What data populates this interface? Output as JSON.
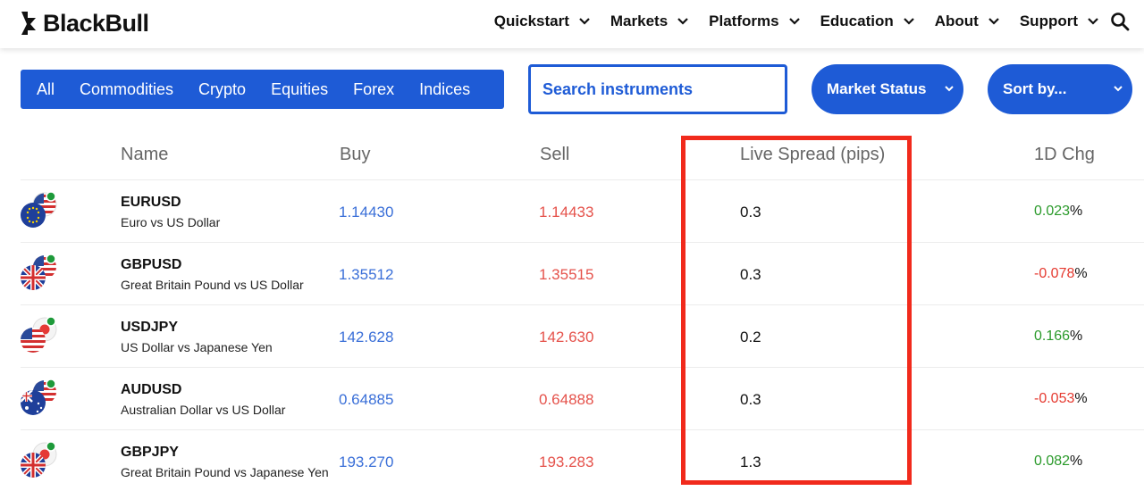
{
  "brand": {
    "name": "BlackBull"
  },
  "nav": {
    "items": [
      {
        "label": "Quickstart"
      },
      {
        "label": "Markets"
      },
      {
        "label": "Platforms"
      },
      {
        "label": "Education"
      },
      {
        "label": "About"
      },
      {
        "label": "Support"
      }
    ]
  },
  "filters": {
    "categories": [
      "All",
      "Commodities",
      "Crypto",
      "Equities",
      "Forex",
      "Indices"
    ],
    "search_placeholder": "Search instruments",
    "market_status_label": "Market Status",
    "sort_label": "Sort by..."
  },
  "table": {
    "headers": {
      "name": "Name",
      "buy": "Buy",
      "sell": "Sell",
      "spread": "Live Spread (pips)",
      "change": "1D Chg"
    },
    "rows": [
      {
        "symbol": "EURUSD",
        "description": "Euro vs US Dollar",
        "buy": "1.14430",
        "sell": "1.14433",
        "spread": "0.3",
        "change": "0.023",
        "change_direction": "up",
        "flag": "eu-us-flag-icon"
      },
      {
        "symbol": "GBPUSD",
        "description": "Great Britain Pound vs US Dollar",
        "buy": "1.35512",
        "sell": "1.35515",
        "spread": "0.3",
        "change": "-0.078",
        "change_direction": "down",
        "flag": "gb-us-flag-icon"
      },
      {
        "symbol": "USDJPY",
        "description": "US Dollar vs Japanese Yen",
        "buy": "142.628",
        "sell": "142.630",
        "spread": "0.2",
        "change": "0.166",
        "change_direction": "up",
        "flag": "us-jp-flag-icon"
      },
      {
        "symbol": "AUDUSD",
        "description": "Australian Dollar vs US Dollar",
        "buy": "0.64885",
        "sell": "0.64888",
        "spread": "0.3",
        "change": "-0.053",
        "change_direction": "down",
        "flag": "au-us-flag-icon"
      },
      {
        "symbol": "GBPJPY",
        "description": "Great Britain Pound vs Japanese Yen",
        "buy": "193.270",
        "sell": "193.283",
        "spread": "1.3",
        "change": "0.082",
        "change_direction": "up",
        "flag": "gb-jp-flag-icon"
      }
    ],
    "percent_sign": "%"
  },
  "colors": {
    "brand_blue": "#1e5bd6",
    "buy": "#3a6fd8",
    "sell": "#e5524b",
    "positive": "#2a9a2a",
    "negative": "#e5392f",
    "highlight": "#f12a1c",
    "market_open_dot": "#1e9a3a",
    "market_closed_dot": "#e53935"
  }
}
